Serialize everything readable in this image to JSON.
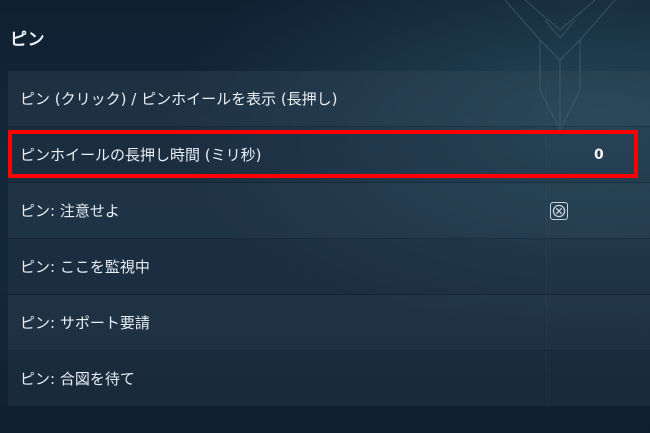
{
  "section": {
    "title": "ピン"
  },
  "settings": [
    {
      "label": "ピン (クリック) / ピンホイールを表示 (長押し)",
      "value": "",
      "control": "none"
    },
    {
      "label": "ピンホイールの長押し時間 (ミリ秒)",
      "value": "0",
      "control": "number",
      "highlighted": true
    },
    {
      "label": "ピン: 注意せよ",
      "value": "",
      "control": "checkbox",
      "checked": false
    },
    {
      "label": "ピン: ここを監視中",
      "value": "",
      "control": "none"
    },
    {
      "label": "ピン: サポート要請",
      "value": "",
      "control": "none"
    },
    {
      "label": "ピン: 合図を待て",
      "value": "",
      "control": "none"
    }
  ],
  "colors": {
    "highlight": "#ff0000",
    "background": "#13273a",
    "text": "#e9eef3"
  },
  "icons": {
    "checkbox": "circle-x-icon",
    "ornament": "background-ornament"
  }
}
